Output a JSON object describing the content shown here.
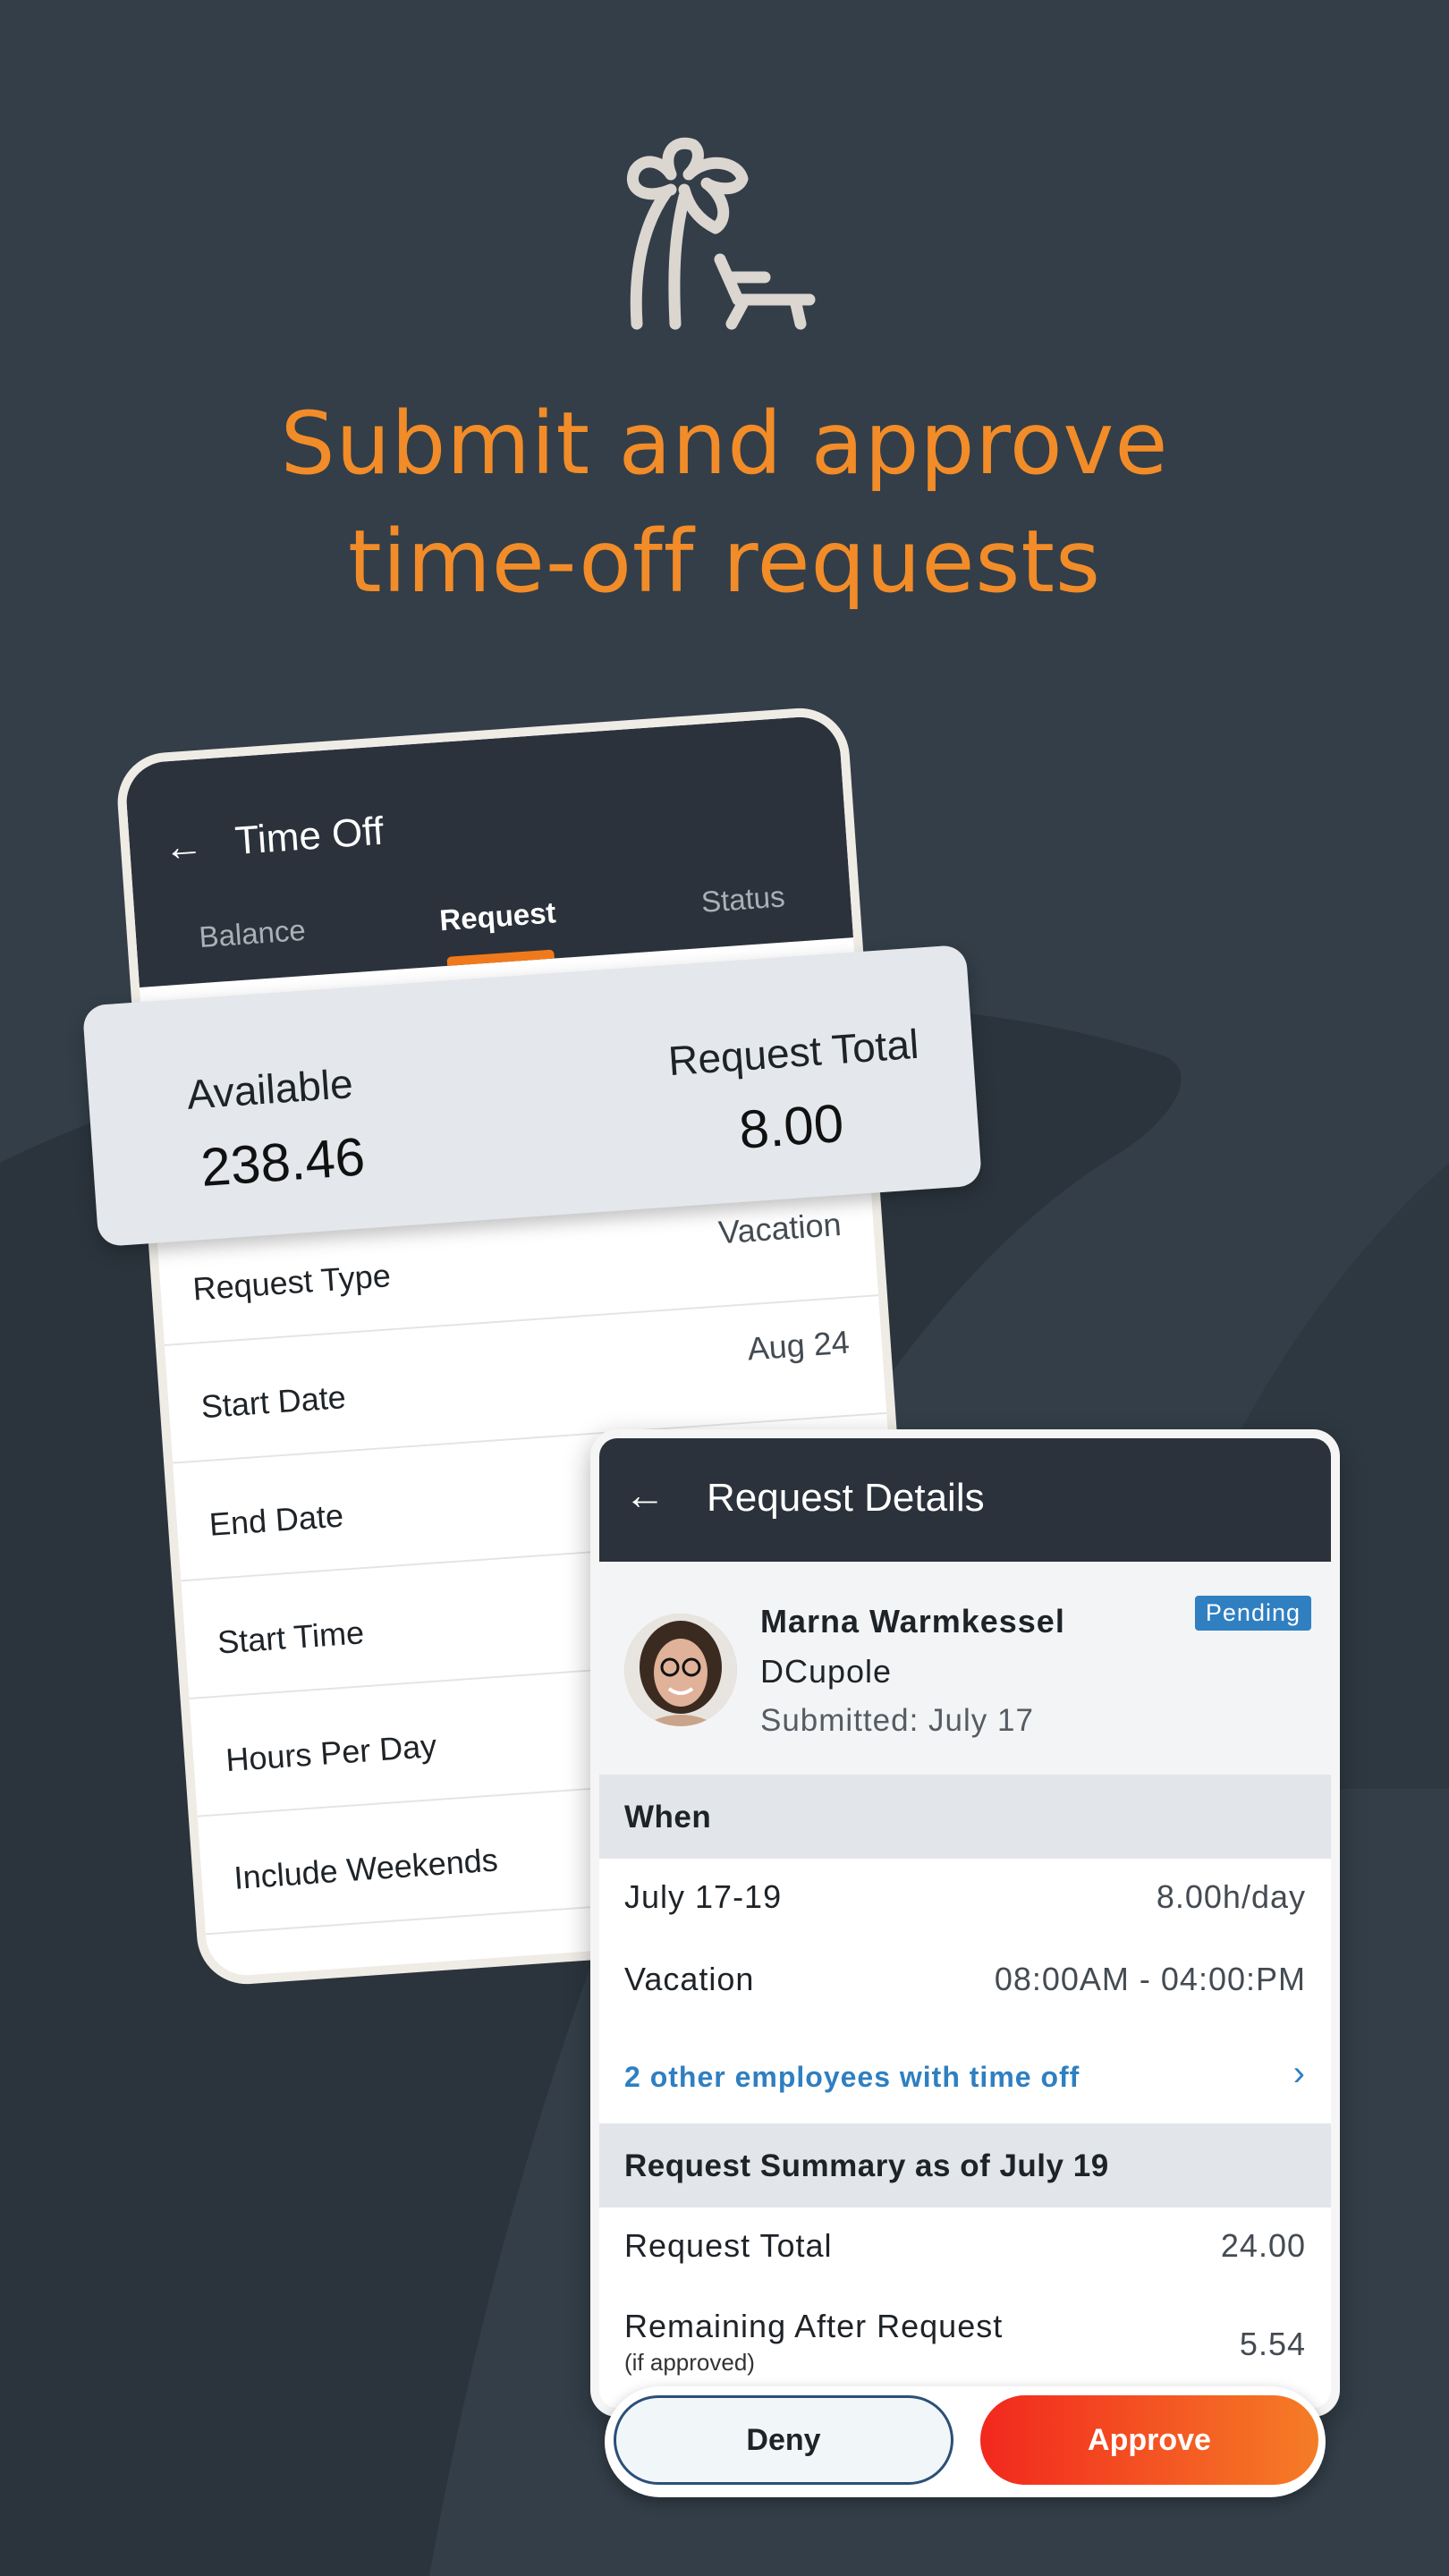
{
  "headline": {
    "line1": "Submit and approve",
    "line2": "time-off requests"
  },
  "icons": {
    "hero": "palm-tree-beach-chair-icon",
    "back": "arrow-left-icon",
    "chevron": "chevron-right-icon"
  },
  "colors": {
    "background": "#333e48",
    "accent": "#f28c28",
    "header": "#2b323b",
    "link": "#2f7fc1",
    "approve": "#f2281e"
  },
  "time_off_screen": {
    "title": "Time Off",
    "tabs": [
      {
        "label": "Balance"
      },
      {
        "label": "Request",
        "active": true
      },
      {
        "label": "Status"
      }
    ],
    "available_label": "Available",
    "available_value": "238.46",
    "request_total_label": "Request Total",
    "request_total_value": "8.00",
    "rows": [
      {
        "label": "Request Type",
        "value": "Vacation"
      },
      {
        "label": "Start Date",
        "value": "Aug 24"
      },
      {
        "label": "End Date",
        "value": ""
      },
      {
        "label": "Start Time",
        "value": ""
      },
      {
        "label": "Hours Per Day",
        "value": ""
      },
      {
        "label": "Include Weekends",
        "value": ""
      }
    ]
  },
  "request_details": {
    "title": "Request Details",
    "employee_name": "Marna Warmkessel",
    "organization": "DCupole",
    "submitted": "Submitted: July 17",
    "status": "Pending",
    "when_header": "When",
    "dates": "July 17-19",
    "hours_per_day": "8.00h/day",
    "type": "Vacation",
    "time_range": "08:00AM - 04:00:PM",
    "others_link": "2 other employees with time off",
    "summary_header": "Request Summary as of July 19",
    "request_total_label": "Request Total",
    "request_total_value": "24.00",
    "remaining_label": "Remaining After Request",
    "remaining_note": "(if approved)",
    "remaining_value": "5.54",
    "deny_label": "Deny",
    "approve_label": "Approve"
  }
}
